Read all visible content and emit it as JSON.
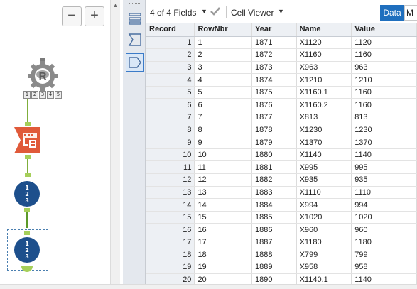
{
  "canvas": {
    "zoom_out_label": "−",
    "zoom_in_label": "+",
    "r_tool": {
      "icon": "r-tool-icon",
      "badges": [
        "1",
        "2",
        "3",
        "4",
        "5"
      ]
    },
    "multirow_numbers": [
      "1",
      "2",
      "3"
    ],
    "colors": {
      "connector": "#7fae3c",
      "anchor": "#a6cf5a",
      "append_tool": "#e05a3a",
      "multirow_tool": "#1d4f8c",
      "selection": "#4a7fb0"
    }
  },
  "results": {
    "fields_label": "4 of 4 Fields",
    "viewer_label": "Cell Viewer",
    "data_button": "Data",
    "meta_button": "M",
    "colors": {
      "data_button": "#1f6fbe",
      "header_bg": "#edf0f4",
      "toolbar_bg": "#e4e8ee"
    },
    "columns": [
      "Record",
      "RowNbr",
      "Year",
      "Name",
      "Value"
    ],
    "rows": [
      [
        "1",
        "1",
        "1871",
        "X1120",
        "1120"
      ],
      [
        "2",
        "2",
        "1872",
        "X1160",
        "1160"
      ],
      [
        "3",
        "3",
        "1873",
        "X963",
        "963"
      ],
      [
        "4",
        "4",
        "1874",
        "X1210",
        "1210"
      ],
      [
        "5",
        "5",
        "1875",
        "X1160.1",
        "1160"
      ],
      [
        "6",
        "6",
        "1876",
        "X1160.2",
        "1160"
      ],
      [
        "7",
        "7",
        "1877",
        "X813",
        "813"
      ],
      [
        "8",
        "8",
        "1878",
        "X1230",
        "1230"
      ],
      [
        "9",
        "9",
        "1879",
        "X1370",
        "1370"
      ],
      [
        "10",
        "10",
        "1880",
        "X1140",
        "1140"
      ],
      [
        "11",
        "11",
        "1881",
        "X995",
        "995"
      ],
      [
        "12",
        "12",
        "1882",
        "X935",
        "935"
      ],
      [
        "13",
        "13",
        "1883",
        "X1110",
        "1110"
      ],
      [
        "14",
        "14",
        "1884",
        "X994",
        "994"
      ],
      [
        "15",
        "15",
        "1885",
        "X1020",
        "1020"
      ],
      [
        "16",
        "16",
        "1886",
        "X960",
        "960"
      ],
      [
        "17",
        "17",
        "1887",
        "X1180",
        "1180"
      ],
      [
        "18",
        "18",
        "1888",
        "X799",
        "799"
      ],
      [
        "19",
        "19",
        "1889",
        "X958",
        "958"
      ],
      [
        "20",
        "20",
        "1890",
        "X1140.1",
        "1140"
      ]
    ]
  }
}
